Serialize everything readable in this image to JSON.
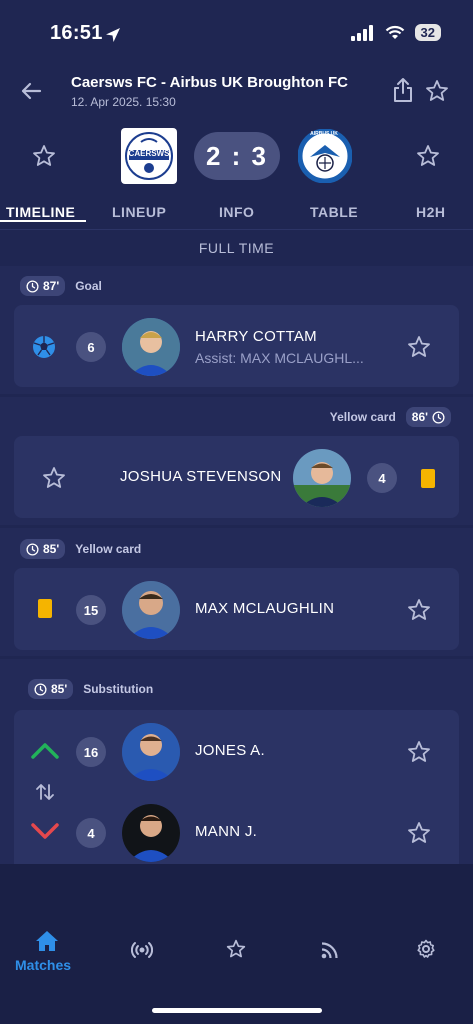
{
  "status_bar": {
    "time": "16:51",
    "battery": "32"
  },
  "header": {
    "title": "Caersws FC - Airbus UK Broughton FC",
    "date": "12. Apr 2025. 15:30"
  },
  "match": {
    "score": "2 : 3",
    "home_logo_text": "CAERSWS",
    "away_logo_text": "AIRBUS UK"
  },
  "tabs": [
    "TIMELINE",
    "LINEUP",
    "INFO",
    "TABLE",
    "H2H"
  ],
  "full_time_label": "FULL TIME",
  "events": {
    "goal": {
      "minute": "87'",
      "type": "Goal",
      "number": "6",
      "player": "HARRY COTTAM",
      "assist": "Assist: MAX MCLAUGHL..."
    },
    "yellow_away": {
      "minute": "86'",
      "type": "Yellow card",
      "number": "4",
      "player": "JOSHUA STEVENSON"
    },
    "yellow_home": {
      "minute": "85'",
      "type": "Yellow card",
      "number": "15",
      "player": "MAX MCLAUGHLIN"
    },
    "substitution": {
      "minute": "85'",
      "type": "Substitution",
      "in_number": "16",
      "in_player": "JONES A.",
      "out_number": "4",
      "out_player": "MANN J."
    }
  },
  "bottom_nav": {
    "matches_label": "Matches"
  },
  "colors": {
    "background": "#1f2652",
    "card": "#2b3364",
    "accent": "#2f8fe8",
    "yellow_card": "#f5b400",
    "sub_in": "#22b35a",
    "sub_out": "#e5484d"
  }
}
